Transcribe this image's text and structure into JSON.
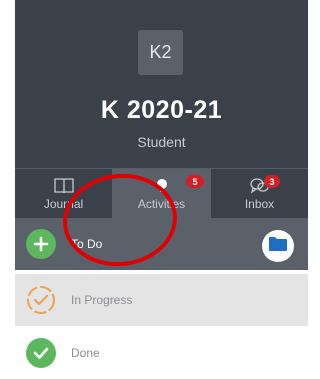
{
  "header": {
    "avatar_initials": "K2",
    "class_name": "K 2020-21",
    "role": "Student"
  },
  "tabs": [
    {
      "label": "Journal",
      "icon": "book-icon"
    },
    {
      "label": "Activities",
      "icon": "lightbulb-icon",
      "badge": "5",
      "selected": true
    },
    {
      "label": "Inbox",
      "icon": "chat-bubbles-icon",
      "badge": "3"
    }
  ],
  "lists": {
    "todo": {
      "label": "To Do",
      "icon": "plus-circle-icon"
    },
    "in_progress": {
      "label": "In Progress",
      "icon": "progress-circle-icon"
    },
    "done": {
      "label": "Done",
      "icon": "check-circle-icon"
    }
  },
  "actions": {
    "folder_icon": "folder-icon"
  },
  "colors": {
    "header_bg": "#3b414a",
    "selected_bg": "#5a616b",
    "badge": "#d51f27",
    "green": "#5cb85c",
    "orange": "#f0a04b",
    "folder_blue": "#1d6fc4",
    "annotation_red": "#e00000"
  }
}
